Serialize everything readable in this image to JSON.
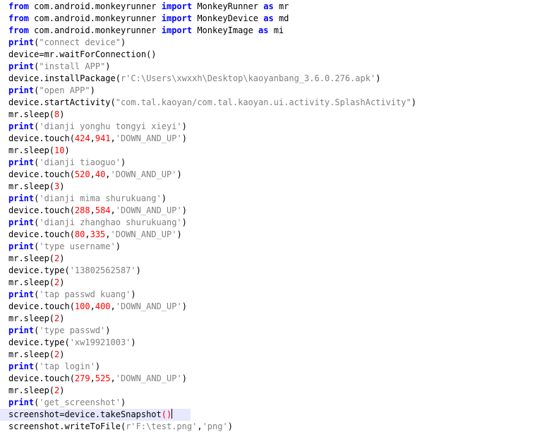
{
  "editor": {
    "lines": [
      [
        {
          "t": "kw",
          "v": "from"
        },
        {
          "t": "plain",
          "v": " com.android.monkeyrunner "
        },
        {
          "t": "kw",
          "v": "import"
        },
        {
          "t": "plain",
          "v": " MonkeyRunner "
        },
        {
          "t": "kw",
          "v": "as"
        },
        {
          "t": "plain",
          "v": " mr"
        }
      ],
      [
        {
          "t": "kw",
          "v": "from"
        },
        {
          "t": "plain",
          "v": " com.android.monkeyrunner "
        },
        {
          "t": "kw",
          "v": "import"
        },
        {
          "t": "plain",
          "v": " MonkeyDevice "
        },
        {
          "t": "kw",
          "v": "as"
        },
        {
          "t": "plain",
          "v": " md"
        }
      ],
      [
        {
          "t": "kw",
          "v": "from"
        },
        {
          "t": "plain",
          "v": " com.android.monkeyrunner "
        },
        {
          "t": "kw",
          "v": "import"
        },
        {
          "t": "plain",
          "v": " MonkeyImage "
        },
        {
          "t": "kw",
          "v": "as"
        },
        {
          "t": "plain",
          "v": " mi"
        }
      ],
      [
        {
          "t": "kw",
          "v": "print"
        },
        {
          "t": "plain",
          "v": "("
        },
        {
          "t": "str",
          "v": "\"connect device\""
        },
        {
          "t": "plain",
          "v": ")"
        }
      ],
      [
        {
          "t": "plain",
          "v": "device=mr.waitForConnection()"
        }
      ],
      [
        {
          "t": "kw",
          "v": "print"
        },
        {
          "t": "plain",
          "v": "("
        },
        {
          "t": "str",
          "v": "\"install APP\""
        },
        {
          "t": "plain",
          "v": ")"
        }
      ],
      [
        {
          "t": "plain",
          "v": "device.installPackage("
        },
        {
          "t": "str",
          "v": "r'C:\\Users\\xwxxh\\Desktop\\kaoyanbang_3.6.0.276.apk'"
        },
        {
          "t": "plain",
          "v": ")"
        }
      ],
      [
        {
          "t": "kw",
          "v": "print"
        },
        {
          "t": "plain",
          "v": "("
        },
        {
          "t": "str",
          "v": "\"open APP\""
        },
        {
          "t": "plain",
          "v": ")"
        }
      ],
      [
        {
          "t": "plain",
          "v": "device.startActivity("
        },
        {
          "t": "str",
          "v": "\"com.tal.kaoyan/com.tal.kaoyan.ui.activity.SplashActivity\""
        },
        {
          "t": "plain",
          "v": ")"
        }
      ],
      [
        {
          "t": "plain",
          "v": "mr.sleep("
        },
        {
          "t": "num",
          "v": "8"
        },
        {
          "t": "plain",
          "v": ")"
        }
      ],
      [
        {
          "t": "kw",
          "v": "print"
        },
        {
          "t": "plain",
          "v": "("
        },
        {
          "t": "str",
          "v": "'dianji yonghu tongyi xieyi'"
        },
        {
          "t": "plain",
          "v": ")"
        }
      ],
      [
        {
          "t": "plain",
          "v": "device.touch("
        },
        {
          "t": "num",
          "v": "424"
        },
        {
          "t": "plain",
          "v": ","
        },
        {
          "t": "num",
          "v": "941"
        },
        {
          "t": "plain",
          "v": ","
        },
        {
          "t": "str",
          "v": "'DOWN_AND_UP'"
        },
        {
          "t": "plain",
          "v": ")"
        }
      ],
      [
        {
          "t": "plain",
          "v": "mr.sleep("
        },
        {
          "t": "num",
          "v": "10"
        },
        {
          "t": "plain",
          "v": ")"
        }
      ],
      [
        {
          "t": "kw",
          "v": "print"
        },
        {
          "t": "plain",
          "v": "("
        },
        {
          "t": "str",
          "v": "'dianji tiaoguo'"
        },
        {
          "t": "plain",
          "v": ")"
        }
      ],
      [
        {
          "t": "plain",
          "v": "device.touch("
        },
        {
          "t": "num",
          "v": "520"
        },
        {
          "t": "plain",
          "v": ","
        },
        {
          "t": "num",
          "v": "40"
        },
        {
          "t": "plain",
          "v": ","
        },
        {
          "t": "str",
          "v": "'DOWN_AND_UP'"
        },
        {
          "t": "plain",
          "v": ")"
        }
      ],
      [
        {
          "t": "plain",
          "v": "mr.sleep("
        },
        {
          "t": "num",
          "v": "3"
        },
        {
          "t": "plain",
          "v": ")"
        }
      ],
      [
        {
          "t": "kw",
          "v": "print"
        },
        {
          "t": "plain",
          "v": "("
        },
        {
          "t": "str",
          "v": "'dianji mima shurukuang'"
        },
        {
          "t": "plain",
          "v": ")"
        }
      ],
      [
        {
          "t": "plain",
          "v": "device.touch("
        },
        {
          "t": "num",
          "v": "288"
        },
        {
          "t": "plain",
          "v": ","
        },
        {
          "t": "num",
          "v": "584"
        },
        {
          "t": "plain",
          "v": ","
        },
        {
          "t": "str",
          "v": "'DOWN_AND_UP'"
        },
        {
          "t": "plain",
          "v": ")"
        }
      ],
      [
        {
          "t": "kw",
          "v": "print"
        },
        {
          "t": "plain",
          "v": "("
        },
        {
          "t": "str",
          "v": "'dianji zhanghao shurukuang'"
        },
        {
          "t": "plain",
          "v": ")"
        }
      ],
      [
        {
          "t": "plain",
          "v": "device.touch("
        },
        {
          "t": "num",
          "v": "80"
        },
        {
          "t": "plain",
          "v": ","
        },
        {
          "t": "num",
          "v": "335"
        },
        {
          "t": "plain",
          "v": ","
        },
        {
          "t": "str",
          "v": "'DOWN_AND_UP'"
        },
        {
          "t": "plain",
          "v": ")"
        }
      ],
      [
        {
          "t": "kw",
          "v": "print"
        },
        {
          "t": "plain",
          "v": "("
        },
        {
          "t": "str",
          "v": "'type username'"
        },
        {
          "t": "plain",
          "v": ")"
        }
      ],
      [
        {
          "t": "plain",
          "v": "mr.sleep("
        },
        {
          "t": "num",
          "v": "2"
        },
        {
          "t": "plain",
          "v": ")"
        }
      ],
      [
        {
          "t": "plain",
          "v": "device.type("
        },
        {
          "t": "str",
          "v": "'13802562587'"
        },
        {
          "t": "plain",
          "v": ")"
        }
      ],
      [
        {
          "t": "plain",
          "v": "mr.sleep("
        },
        {
          "t": "num",
          "v": "2"
        },
        {
          "t": "plain",
          "v": ")"
        }
      ],
      [
        {
          "t": "kw",
          "v": "print"
        },
        {
          "t": "plain",
          "v": "("
        },
        {
          "t": "str",
          "v": "'tap passwd kuang'"
        },
        {
          "t": "plain",
          "v": ")"
        }
      ],
      [
        {
          "t": "plain",
          "v": "device.touch("
        },
        {
          "t": "num",
          "v": "100"
        },
        {
          "t": "plain",
          "v": ","
        },
        {
          "t": "num",
          "v": "400"
        },
        {
          "t": "plain",
          "v": ","
        },
        {
          "t": "str",
          "v": "'DOWN_AND_UP'"
        },
        {
          "t": "plain",
          "v": ")"
        }
      ],
      [
        {
          "t": "plain",
          "v": "mr.sleep("
        },
        {
          "t": "num",
          "v": "2"
        },
        {
          "t": "plain",
          "v": ")"
        }
      ],
      [
        {
          "t": "kw",
          "v": "print"
        },
        {
          "t": "plain",
          "v": "("
        },
        {
          "t": "str",
          "v": "'type passwd'"
        },
        {
          "t": "plain",
          "v": ")"
        }
      ],
      [
        {
          "t": "plain",
          "v": "device.type("
        },
        {
          "t": "str",
          "v": "'xw19921003'"
        },
        {
          "t": "plain",
          "v": ")"
        }
      ],
      [
        {
          "t": "plain",
          "v": "mr.sleep("
        },
        {
          "t": "num",
          "v": "2"
        },
        {
          "t": "plain",
          "v": ")"
        }
      ],
      [
        {
          "t": "kw",
          "v": "print"
        },
        {
          "t": "plain",
          "v": "("
        },
        {
          "t": "str",
          "v": "'tap login'"
        },
        {
          "t": "plain",
          "v": ")"
        }
      ],
      [
        {
          "t": "plain",
          "v": "device.touch("
        },
        {
          "t": "num",
          "v": "279"
        },
        {
          "t": "plain",
          "v": ","
        },
        {
          "t": "num",
          "v": "525"
        },
        {
          "t": "plain",
          "v": ","
        },
        {
          "t": "str",
          "v": "'DOWN_AND_UP'"
        },
        {
          "t": "plain",
          "v": ")"
        }
      ],
      [
        {
          "t": "plain",
          "v": "mr.sleep("
        },
        {
          "t": "num",
          "v": "2"
        },
        {
          "t": "plain",
          "v": ")"
        }
      ],
      [
        {
          "t": "kw",
          "v": "print"
        },
        {
          "t": "plain",
          "v": "("
        },
        {
          "t": "str",
          "v": "'get_screenshot'"
        },
        {
          "t": "plain",
          "v": ")"
        }
      ],
      [
        {
          "t": "plain",
          "v": "screenshot=device.takeSnapshot"
        },
        {
          "t": "num",
          "v": "()"
        }
      ],
      [
        {
          "t": "plain",
          "v": "screenshot.writeToFile("
        },
        {
          "t": "str",
          "v": "r'F:\\test.png'"
        },
        {
          "t": "plain",
          "v": ","
        },
        {
          "t": "str",
          "v": "'png'"
        },
        {
          "t": "plain",
          "v": ")"
        }
      ]
    ],
    "current_line": 34
  },
  "colors": {
    "keyword": "#0000ff",
    "string": "#808080",
    "number": "#ff0000",
    "current_line_bg": "#e8e8ff",
    "background": "#ffffff"
  }
}
